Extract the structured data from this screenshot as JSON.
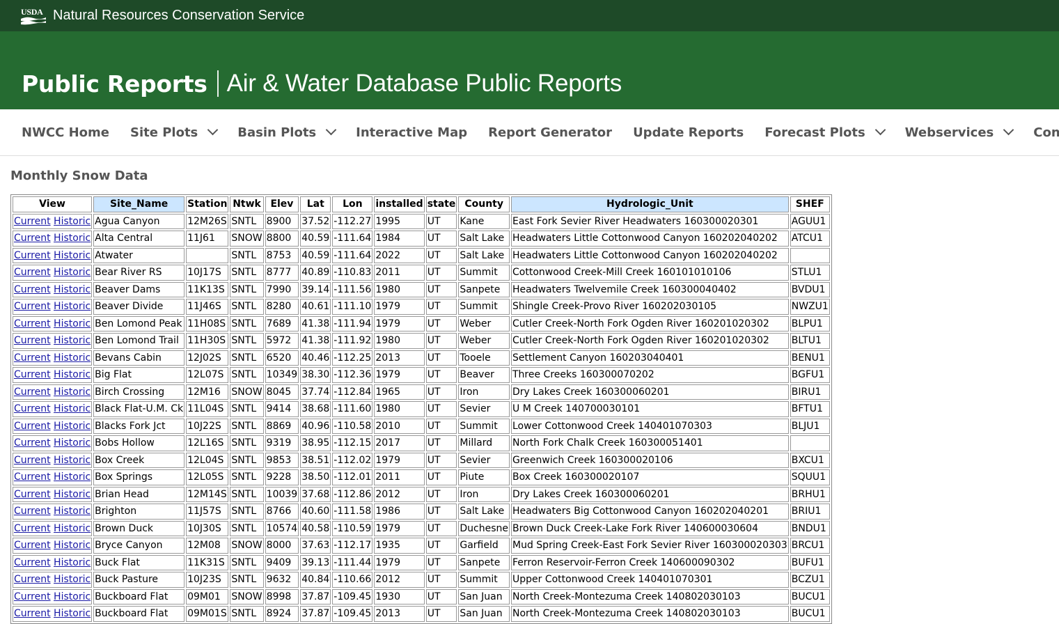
{
  "topbar": {
    "logo_text": "USDA",
    "agency": "Natural Resources Conservation Service"
  },
  "banner": {
    "title": "Public Reports",
    "subtitle": "Air & Water Database Public Reports"
  },
  "nav": [
    {
      "label": "NWCC Home",
      "dropdown": false
    },
    {
      "label": "Site Plots",
      "dropdown": true
    },
    {
      "label": "Basin Plots",
      "dropdown": true
    },
    {
      "label": "Interactive Map",
      "dropdown": false
    },
    {
      "label": "Report Generator",
      "dropdown": false
    },
    {
      "label": "Update Reports",
      "dropdown": false
    },
    {
      "label": "Forecast Plots",
      "dropdown": true
    },
    {
      "label": "Webservices",
      "dropdown": true
    },
    {
      "label": "Contact Us",
      "dropdown": false
    }
  ],
  "page_heading": "Monthly Snow Data",
  "table": {
    "headers": [
      "View",
      "Site_Name",
      "Station",
      "Ntwk",
      "Elev",
      "Lat",
      "Lon",
      "installed",
      "state",
      "County",
      "Hydrologic_Unit",
      "SHEF"
    ],
    "highlighted_headers": [
      "Site_Name",
      "Hydrologic_Unit"
    ],
    "highlight_color": "#cce6ff",
    "link_labels": [
      "Current",
      "Historic"
    ],
    "rows": [
      [
        "Agua Canyon",
        "12M26S",
        "SNTL",
        "8900",
        "37.52",
        "-112.27",
        "1995",
        "UT",
        "Kane",
        "East Fork Sevier River Headwaters 160300020301",
        "AGUU1"
      ],
      [
        "Alta Central",
        "11J61",
        "SNOW",
        "8800",
        "40.59",
        "-111.64",
        "1984",
        "UT",
        "Salt Lake",
        "Headwaters Little Cottonwood Canyon 160202040202",
        "ATCU1"
      ],
      [
        "Atwater",
        "",
        "SNTL",
        "8753",
        "40.59",
        "-111.64",
        "2022",
        "UT",
        "Salt Lake",
        "Headwaters Little Cottonwood Canyon 160202040202",
        ""
      ],
      [
        "Bear River RS",
        "10J17S",
        "SNTL",
        "8777",
        "40.89",
        "-110.83",
        "2011",
        "UT",
        "Summit",
        "Cottonwood Creek-Mill Creek 160101010106",
        "STLU1"
      ],
      [
        "Beaver Dams",
        "11K13S",
        "SNTL",
        "7990",
        "39.14",
        "-111.56",
        "1980",
        "UT",
        "Sanpete",
        "Headwaters Twelvemile Creek 160300040402",
        "BVDU1"
      ],
      [
        "Beaver Divide",
        "11J46S",
        "SNTL",
        "8280",
        "40.61",
        "-111.10",
        "1979",
        "UT",
        "Summit",
        "Shingle Creek-Provo River 160202030105",
        "NWZU1"
      ],
      [
        "Ben Lomond Peak",
        "11H08S",
        "SNTL",
        "7689",
        "41.38",
        "-111.94",
        "1979",
        "UT",
        "Weber",
        "Cutler Creek-North Fork Ogden River 160201020302",
        "BLPU1"
      ],
      [
        "Ben Lomond Trail",
        "11H30S",
        "SNTL",
        "5972",
        "41.38",
        "-111.92",
        "1980",
        "UT",
        "Weber",
        "Cutler Creek-North Fork Ogden River 160201020302",
        "BLTU1"
      ],
      [
        "Bevans Cabin",
        "12J02S",
        "SNTL",
        "6520",
        "40.46",
        "-112.25",
        "2013",
        "UT",
        "Tooele",
        "Settlement Canyon 160203040401",
        "BENU1"
      ],
      [
        "Big Flat",
        "12L07S",
        "SNTL",
        "10349",
        "38.30",
        "-112.36",
        "1979",
        "UT",
        "Beaver",
        "Three Creeks 160300070202",
        "BGFU1"
      ],
      [
        "Birch Crossing",
        "12M16",
        "SNOW",
        "8045",
        "37.74",
        "-112.84",
        "1965",
        "UT",
        "Iron",
        "Dry Lakes Creek 160300060201",
        "BIRU1"
      ],
      [
        "Black Flat-U.M. Ck",
        "11L04S",
        "SNTL",
        "9414",
        "38.68",
        "-111.60",
        "1980",
        "UT",
        "Sevier",
        "U M Creek 140700030101",
        "BFTU1"
      ],
      [
        "Blacks Fork Jct",
        "10J22S",
        "SNTL",
        "8869",
        "40.96",
        "-110.58",
        "2010",
        "UT",
        "Summit",
        "Lower Cottonwood Creek 140401070303",
        "BLJU1"
      ],
      [
        "Bobs Hollow",
        "12L16S",
        "SNTL",
        "9319",
        "38.95",
        "-112.15",
        "2017",
        "UT",
        "Millard",
        "North Fork Chalk Creek 160300051401",
        ""
      ],
      [
        "Box Creek",
        "12L04S",
        "SNTL",
        "9853",
        "38.51",
        "-112.02",
        "1979",
        "UT",
        "Sevier",
        "Greenwich Creek 160300020106",
        "BXCU1"
      ],
      [
        "Box Springs",
        "12L05S",
        "SNTL",
        "9228",
        "38.50",
        "-112.01",
        "2011",
        "UT",
        "Piute",
        "Box Creek 160300020107",
        "SQUU1"
      ],
      [
        "Brian Head",
        "12M14S",
        "SNTL",
        "10039",
        "37.68",
        "-112.86",
        "2012",
        "UT",
        "Iron",
        "Dry Lakes Creek 160300060201",
        "BRHU1"
      ],
      [
        "Brighton",
        "11J57S",
        "SNTL",
        "8766",
        "40.60",
        "-111.58",
        "1986",
        "UT",
        "Salt Lake",
        "Headwaters Big Cottonwood Canyon 160202040201",
        "BRIU1"
      ],
      [
        "Brown Duck",
        "10J30S",
        "SNTL",
        "10574",
        "40.58",
        "-110.59",
        "1979",
        "UT",
        "Duchesne",
        "Brown Duck Creek-Lake Fork River 140600030604",
        "BNDU1"
      ],
      [
        "Bryce Canyon",
        "12M08",
        "SNOW",
        "8000",
        "37.63",
        "-112.17",
        "1935",
        "UT",
        "Garfield",
        "Mud Spring Creek-East Fork Sevier River 160300020303",
        "BRCU1"
      ],
      [
        "Buck Flat",
        "11K31S",
        "SNTL",
        "9409",
        "39.13",
        "-111.44",
        "1979",
        "UT",
        "Sanpete",
        "Ferron Reservoir-Ferron Creek 140600090302",
        "BUFU1"
      ],
      [
        "Buck Pasture",
        "10J23S",
        "SNTL",
        "9632",
        "40.84",
        "-110.66",
        "2012",
        "UT",
        "Summit",
        "Upper Cottonwood Creek 140401070301",
        "BCZU1"
      ],
      [
        "Buckboard Flat",
        "09M01",
        "SNOW",
        "8998",
        "37.87",
        "-109.45",
        "1930",
        "UT",
        "San Juan",
        "North Creek-Montezuma Creek 140802030103",
        "BUCU1"
      ],
      [
        "Buckboard Flat",
        "09M01S",
        "SNTL",
        "8924",
        "37.87",
        "-109.45",
        "2013",
        "UT",
        "San Juan",
        "North Creek-Montezuma Creek 140802030103",
        "BUCU1"
      ]
    ]
  }
}
